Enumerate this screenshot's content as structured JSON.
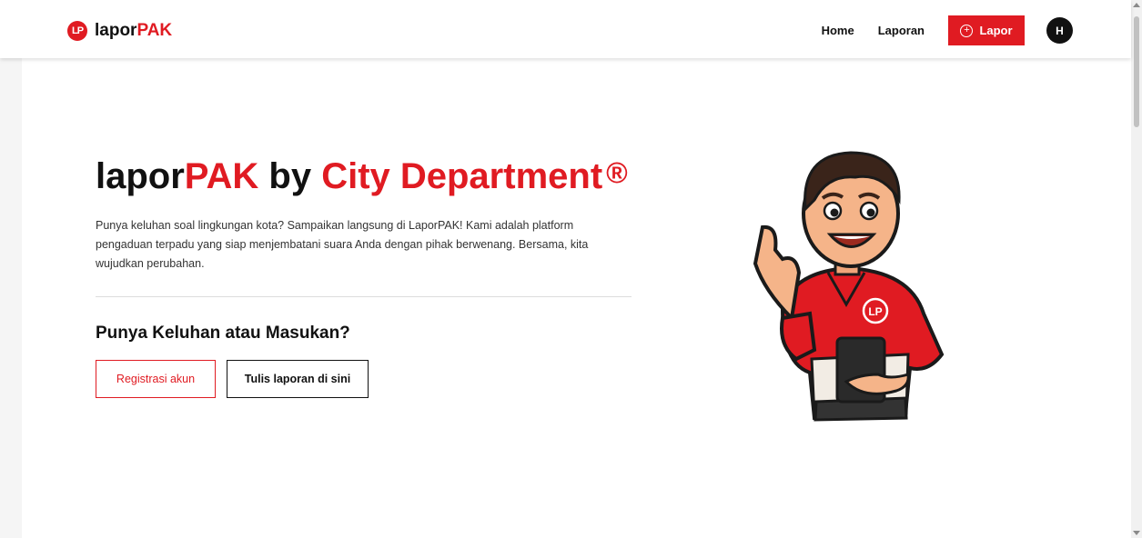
{
  "brand": {
    "logo_text": "LP",
    "name_plain": "lapor",
    "name_accent": "PAK"
  },
  "nav": {
    "home": "Home",
    "laporan": "Laporan",
    "lapor_button": "Lapor",
    "lapor_icon": "plus-circle-icon",
    "avatar_initial": "H"
  },
  "hero": {
    "title_part1": "lapor",
    "title_part2": "PAK",
    "title_part3": " by ",
    "title_part4": "City Department",
    "title_mark": "®",
    "description": "Punya keluhan soal lingkungan kota? Sampaikan langsung di LaporPAK! Kami adalah platform pengaduan terpadu yang siap menjembatani suara Anda dengan pihak berwenang. Bersama, kita wujudkan perubahan.",
    "cta_title": "Punya Keluhan atau Masukan?",
    "register_button": "Registrasi akun",
    "write_button": "Tulis laporan di sini"
  },
  "mascot": {
    "badge_text": "LP"
  },
  "colors": {
    "accent": "#e01b22",
    "text": "#111111"
  }
}
